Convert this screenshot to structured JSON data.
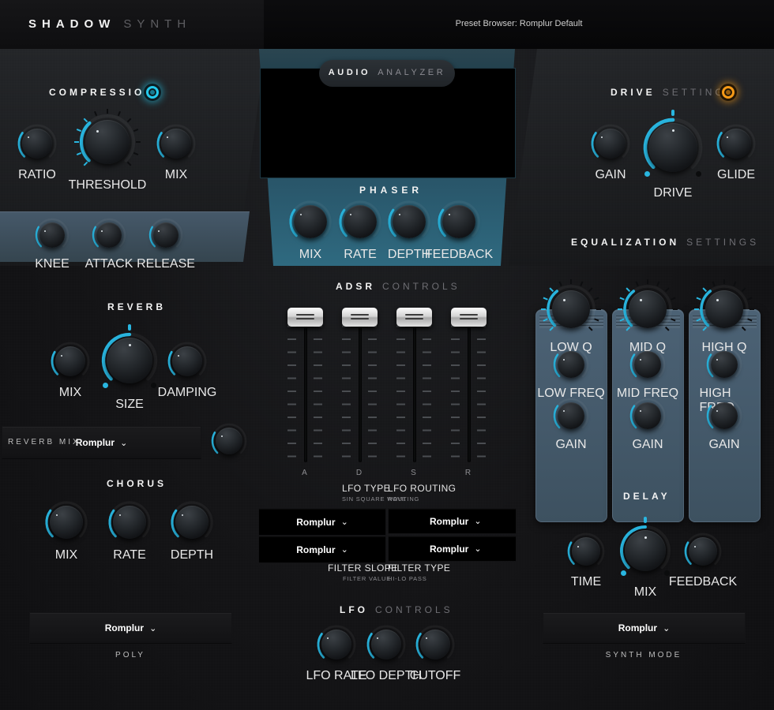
{
  "header": {
    "logo_primary": "SHADOW",
    "logo_secondary": "SYNTH",
    "preset_browser": "Preset Browser: Romplur Default"
  },
  "compression": {
    "title_primary": "COMPRESSION",
    "led_color": "#24c9ec",
    "knobs": [
      {
        "label": "RATIO"
      },
      {
        "label": "THRESHOLD"
      },
      {
        "label": "MIX"
      }
    ],
    "sub_knobs": [
      {
        "label": "KNEE"
      },
      {
        "label": "ATTACK"
      },
      {
        "label": "RELEASE"
      }
    ]
  },
  "analyzer": {
    "title_primary": "AUDIO",
    "title_secondary": "ANALYZER"
  },
  "phaser": {
    "title": "PHASER",
    "knobs": [
      {
        "label": "MIX"
      },
      {
        "label": "RATE"
      },
      {
        "label": "DEPTH"
      },
      {
        "label": "FEEDBACK"
      }
    ]
  },
  "drive": {
    "title_primary": "DRIVE",
    "title_secondary": "SETTINGS",
    "led_color": "#f59a17",
    "knobs": [
      {
        "label": "GAIN"
      },
      {
        "label": "DRIVE"
      },
      {
        "label": "GLIDE"
      }
    ]
  },
  "equalization": {
    "title_primary": "EQUALIZATION",
    "title_secondary": "SETTINGS",
    "columns": [
      {
        "q": "LOW Q",
        "freq": "LOW FREQ",
        "gain": "GAIN"
      },
      {
        "q": "MID Q",
        "freq": "MID FREQ",
        "gain": "GAIN"
      },
      {
        "q": "HIGH Q",
        "freq": "HIGH FREQ",
        "gain": "GAIN"
      }
    ]
  },
  "reverb": {
    "title": "REVERB",
    "knobs": [
      {
        "label": "MIX"
      },
      {
        "label": "SIZE"
      },
      {
        "label": "DAMPING"
      }
    ],
    "mix_row_label": "REVERB MIX",
    "mix_row_value": "Romplur"
  },
  "chorus": {
    "title": "CHORUS",
    "knobs": [
      {
        "label": "MIX"
      },
      {
        "label": "RATE"
      },
      {
        "label": "DEPTH"
      }
    ],
    "poly_value": "Romplur",
    "poly_label": "POLY"
  },
  "adsr": {
    "title_primary": "ADSR",
    "title_secondary": "CONTROLS",
    "faders": [
      {
        "label": "A"
      },
      {
        "label": "D"
      },
      {
        "label": "S"
      },
      {
        "label": "R"
      }
    ]
  },
  "selectors": {
    "top_left": {
      "title": "LFO TYPE",
      "subtitle": "SIN SQUARE WAVE",
      "value": "Romplur"
    },
    "top_right": {
      "title": "LFO ROUTING",
      "subtitle": "ROUTING",
      "value": "Romplur"
    },
    "bottom_left": {
      "title": "FILTER SLOPE",
      "subtitle": "FILTER VALUE",
      "value": "Romplur"
    },
    "bottom_right": {
      "title": "FILTER TYPE",
      "subtitle": "HI-LO PASS",
      "value": "Romplur"
    }
  },
  "lfo": {
    "title_primary": "LFO",
    "title_secondary": "CONTROLS",
    "knobs": [
      {
        "label": "LFO RATE"
      },
      {
        "label": "LFO DEPTH"
      },
      {
        "label": "CUTOFF"
      }
    ]
  },
  "delay": {
    "title": "DELAY",
    "knobs": [
      {
        "label": "TIME"
      },
      {
        "label": "MIX"
      },
      {
        "label": "FEEDBACK"
      }
    ],
    "mode_value": "Romplur",
    "mode_label": "SYNTH MODE"
  },
  "chevron": "⌄"
}
